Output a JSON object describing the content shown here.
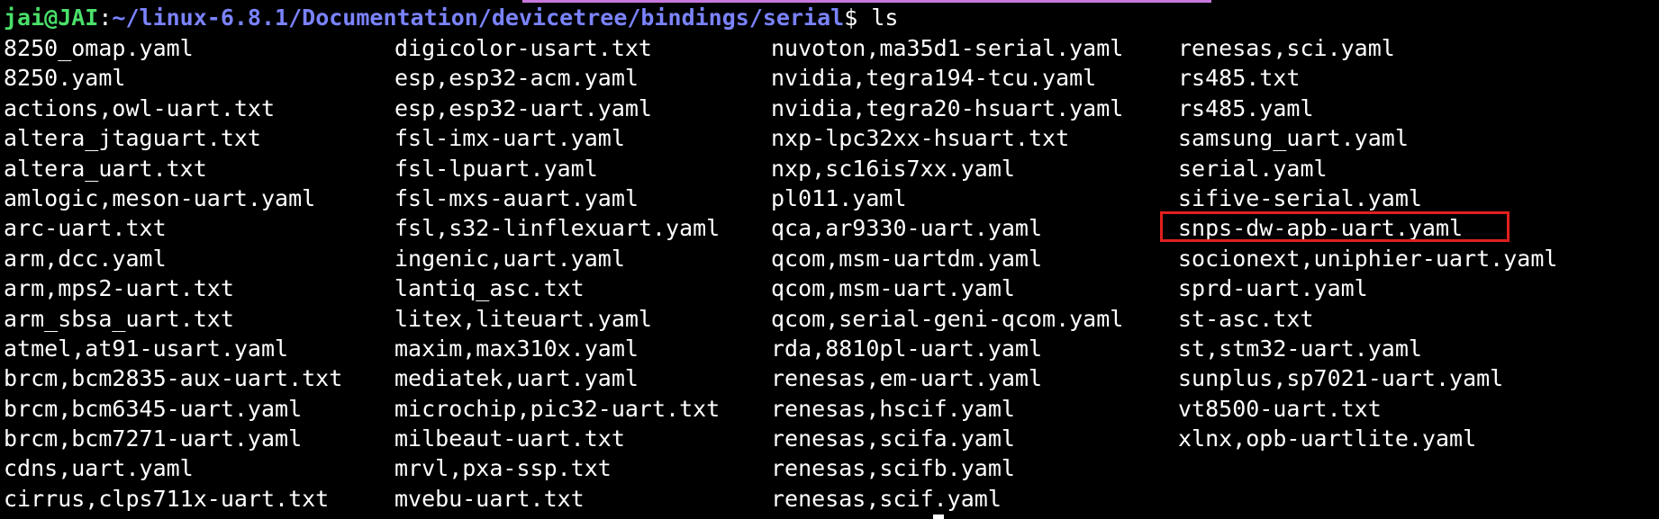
{
  "accent_bar_color": "#c678dd",
  "prompt": {
    "user_host": "jai@JAI",
    "separator": ":",
    "path": "~/linux-6.8.1/Documentation/devicetree/bindings/serial",
    "symbol": "$ ",
    "command": "ls"
  },
  "listing": {
    "columns": [
      [
        "8250_omap.yaml",
        "8250.yaml",
        "actions,owl-uart.txt",
        "altera_jtaguart.txt",
        "altera_uart.txt",
        "amlogic,meson-uart.yaml",
        "arc-uart.txt",
        "arm,dcc.yaml",
        "arm,mps2-uart.txt",
        "arm_sbsa_uart.txt",
        "atmel,at91-usart.yaml",
        "brcm,bcm2835-aux-uart.txt",
        "brcm,bcm6345-uart.yaml",
        "brcm,bcm7271-uart.yaml",
        "cdns,uart.yaml",
        "cirrus,clps711x-uart.txt"
      ],
      [
        "digicolor-usart.txt",
        "esp,esp32-acm.yaml",
        "esp,esp32-uart.yaml",
        "fsl-imx-uart.yaml",
        "fsl-lpuart.yaml",
        "fsl-mxs-auart.yaml",
        "fsl,s32-linflexuart.yaml",
        "ingenic,uart.yaml",
        "lantiq_asc.txt",
        "litex,liteuart.yaml",
        "maxim,max310x.yaml",
        "mediatek,uart.yaml",
        "microchip,pic32-uart.txt",
        "milbeaut-uart.txt",
        "mrvl,pxa-ssp.txt",
        "mvebu-uart.txt"
      ],
      [
        "nuvoton,ma35d1-serial.yaml",
        "nvidia,tegra194-tcu.yaml",
        "nvidia,tegra20-hsuart.yaml",
        "nxp-lpc32xx-hsuart.txt",
        "nxp,sc16is7xx.yaml",
        "pl011.yaml",
        "qca,ar9330-uart.yaml",
        "qcom,msm-uartdm.yaml",
        "qcom,msm-uart.yaml",
        "qcom,serial-geni-qcom.yaml",
        "rda,8810pl-uart.yaml",
        "renesas,em-uart.yaml",
        "renesas,hscif.yaml",
        "renesas,scifa.yaml",
        "renesas,scifb.yaml",
        "renesas,scif.yaml"
      ],
      [
        "renesas,sci.yaml",
        "rs485.txt",
        "rs485.yaml",
        "samsung_uart.yaml",
        "serial.yaml",
        "sifive-serial.yaml",
        "snps-dw-apb-uart.yaml",
        "socionext,uniphier-uart.yaml",
        "sprd-uart.yaml",
        "st-asc.txt",
        "st,stm32-uart.yaml",
        "sunplus,sp7021-uart.yaml",
        "vt8500-uart.txt",
        "xlnx,opb-uartlite.yaml"
      ]
    ]
  },
  "highlighted_file": "snps-dw-apb-uart.yaml",
  "highlight_color": "#e0201e"
}
